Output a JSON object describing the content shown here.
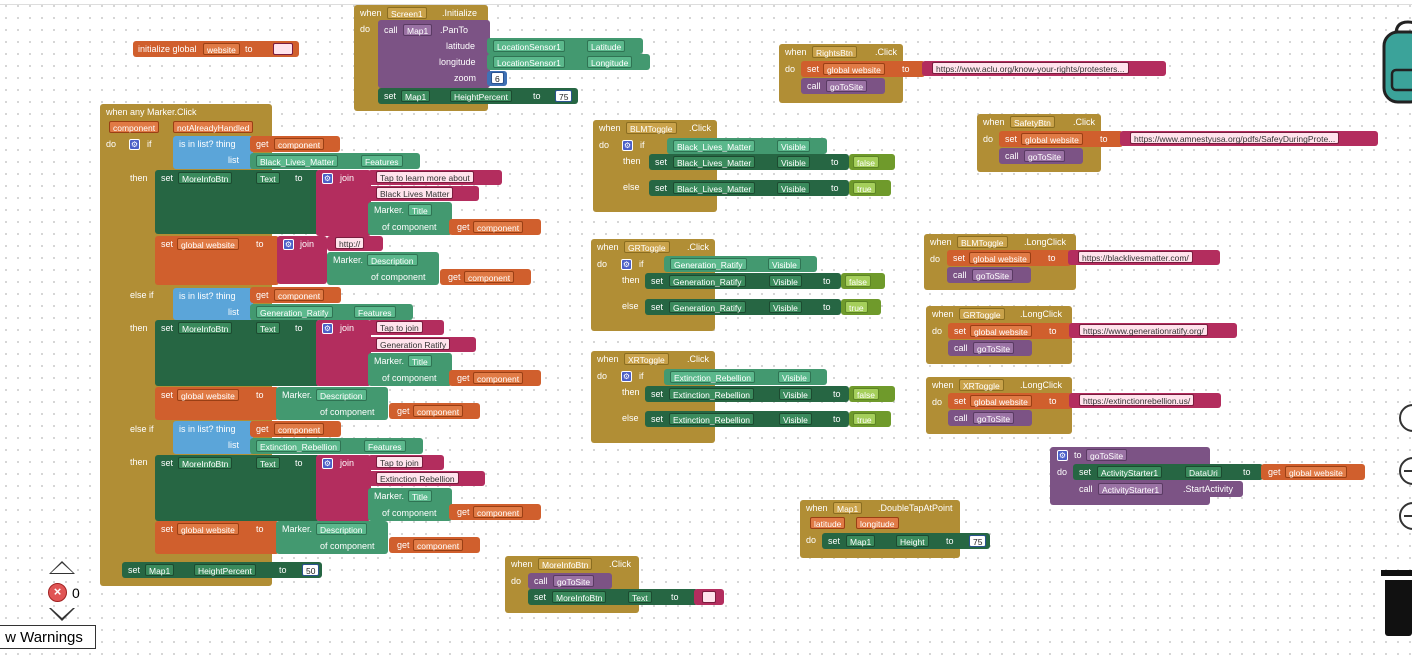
{
  "warnings": {
    "error_count": "0",
    "toggle_label": "w Warnings"
  },
  "init": {
    "keyword": "initialize global",
    "name": "website",
    "to": "to"
  },
  "screen_init": {
    "when": "when",
    "component": "Screen1",
    "event": ".Initialize",
    "do": "do",
    "call": "call",
    "map": "Map1",
    "method": ".PanTo",
    "lat_label": "latitude",
    "lat_comp": "LocationSensor1",
    "lat_prop": "Latitude",
    "lon_label": "longitude",
    "lon_comp": "LocationSensor1",
    "lon_prop": "Longitude",
    "zoom_label": "zoom",
    "zoom_val": "6",
    "set": "set",
    "set_comp": "Map1",
    "set_prop": "HeightPercent",
    "set_to": "to",
    "set_val": "75"
  },
  "marker_click": {
    "header": "when any Marker.Click",
    "param1": "component",
    "param2": "notAlreadyHandled",
    "do": "do",
    "if": "if",
    "isinlist": "is in list? thing",
    "get": "get",
    "get_comp": "component",
    "list": "list",
    "blm_list": "Black_Lives_Matter",
    "features": "Features",
    "then": "then",
    "set": "set",
    "morebtn": "MoreInfoBtn",
    "text": "Text",
    "to": "to",
    "join": "join",
    "blm_learn": "Tap to learn more about",
    "blm_name": "Black Lives Matter",
    "marker": "Marker.",
    "title": "Title",
    "of_comp": "of component",
    "global_web": "global website",
    "http": "http://",
    "description": "Description",
    "elseif": "else if",
    "gr_list": "Generation_Ratify",
    "tap_join": "Tap to join",
    "gr_name": "Generation Ratify",
    "xr_list": "Extinction_Rebellion",
    "xr_name": "Extinction Rebellion",
    "set_map": "Map1",
    "height": "HeightPercent",
    "height_val": "50"
  },
  "rights": {
    "when": "when",
    "comp": "RightsBtn",
    "event": ".Click",
    "do": "do",
    "set": "set",
    "var": "global website",
    "to": "to",
    "url": "https://www.aclu.org/know-your-rights/protesters...",
    "call": "call",
    "proc": "goToSite"
  },
  "safety": {
    "when": "when",
    "comp": "SafetyBtn",
    "event": ".Click",
    "do": "do",
    "set": "set",
    "var": "global website",
    "to": "to",
    "url": "https://www.amnestyusa.org/pdfs/SafeyDuringProte...",
    "call": "call",
    "proc": "goToSite"
  },
  "blm_toggle": {
    "when": "when",
    "comp": "BLMToggle",
    "event": ".Click",
    "do": "do",
    "if": "if",
    "layer": "Black_Lives_Matter",
    "visible": "Visible",
    "then": "then",
    "else": "else",
    "set": "set",
    "to": "to",
    "false": "false",
    "true": "true"
  },
  "gr_toggle": {
    "when": "when",
    "comp": "GRToggle",
    "event": ".Click",
    "do": "do",
    "if": "if",
    "layer": "Generation_Ratify",
    "visible": "Visible",
    "then": "then",
    "else": "else",
    "set": "set",
    "to": "to",
    "false": "false",
    "true": "true"
  },
  "xr_toggle": {
    "when": "when",
    "comp": "XRToggle",
    "event": ".Click",
    "do": "do",
    "if": "if",
    "layer": "Extinction_Rebellion",
    "visible": "Visible",
    "then": "then",
    "else": "else",
    "set": "set",
    "to": "to",
    "false": "false",
    "true": "true"
  },
  "blm_long": {
    "when": "when",
    "comp": "BLMToggle",
    "event": ".LongClick",
    "do": "do",
    "set": "set",
    "var": "global website",
    "to": "to",
    "url": "https://blacklivesmatter.com/",
    "call": "call",
    "proc": "goToSite"
  },
  "gr_long": {
    "when": "when",
    "comp": "GRToggle",
    "event": ".LongClick",
    "do": "do",
    "set": "set",
    "var": "global website",
    "to": "to",
    "url": "https://www.generationratify.org/",
    "call": "call",
    "proc": "goToSite"
  },
  "xr_long": {
    "when": "when",
    "comp": "XRToggle",
    "event": ".LongClick",
    "do": "do",
    "set": "set",
    "var": "global website",
    "to": "to",
    "url": "https://extinctionrebellion.us/",
    "call": "call",
    "proc": "goToSite"
  },
  "gotosite": {
    "to": "to",
    "name": "goToSite",
    "do": "do",
    "set": "set",
    "comp": "ActivityStarter1",
    "prop": "DataUri",
    "setto": "to",
    "get": "get",
    "var": "global website",
    "call": "call",
    "method": ".StartActivity"
  },
  "doubletap": {
    "when": "when",
    "comp": "Map1",
    "event": ".DoubleTapAtPoint",
    "p1": "latitude",
    "p2": "longitude",
    "do": "do",
    "set": "set",
    "set_comp": "Map1",
    "prop": "Height",
    "to": "to",
    "val": "75"
  },
  "moreinfo": {
    "when": "when",
    "comp": "MoreInfoBtn",
    "event": ".Click",
    "do": "do",
    "call": "call",
    "proc": "goToSite",
    "set": "set",
    "set_comp": "MoreInfoBtn",
    "prop": "Text",
    "to": "to"
  }
}
